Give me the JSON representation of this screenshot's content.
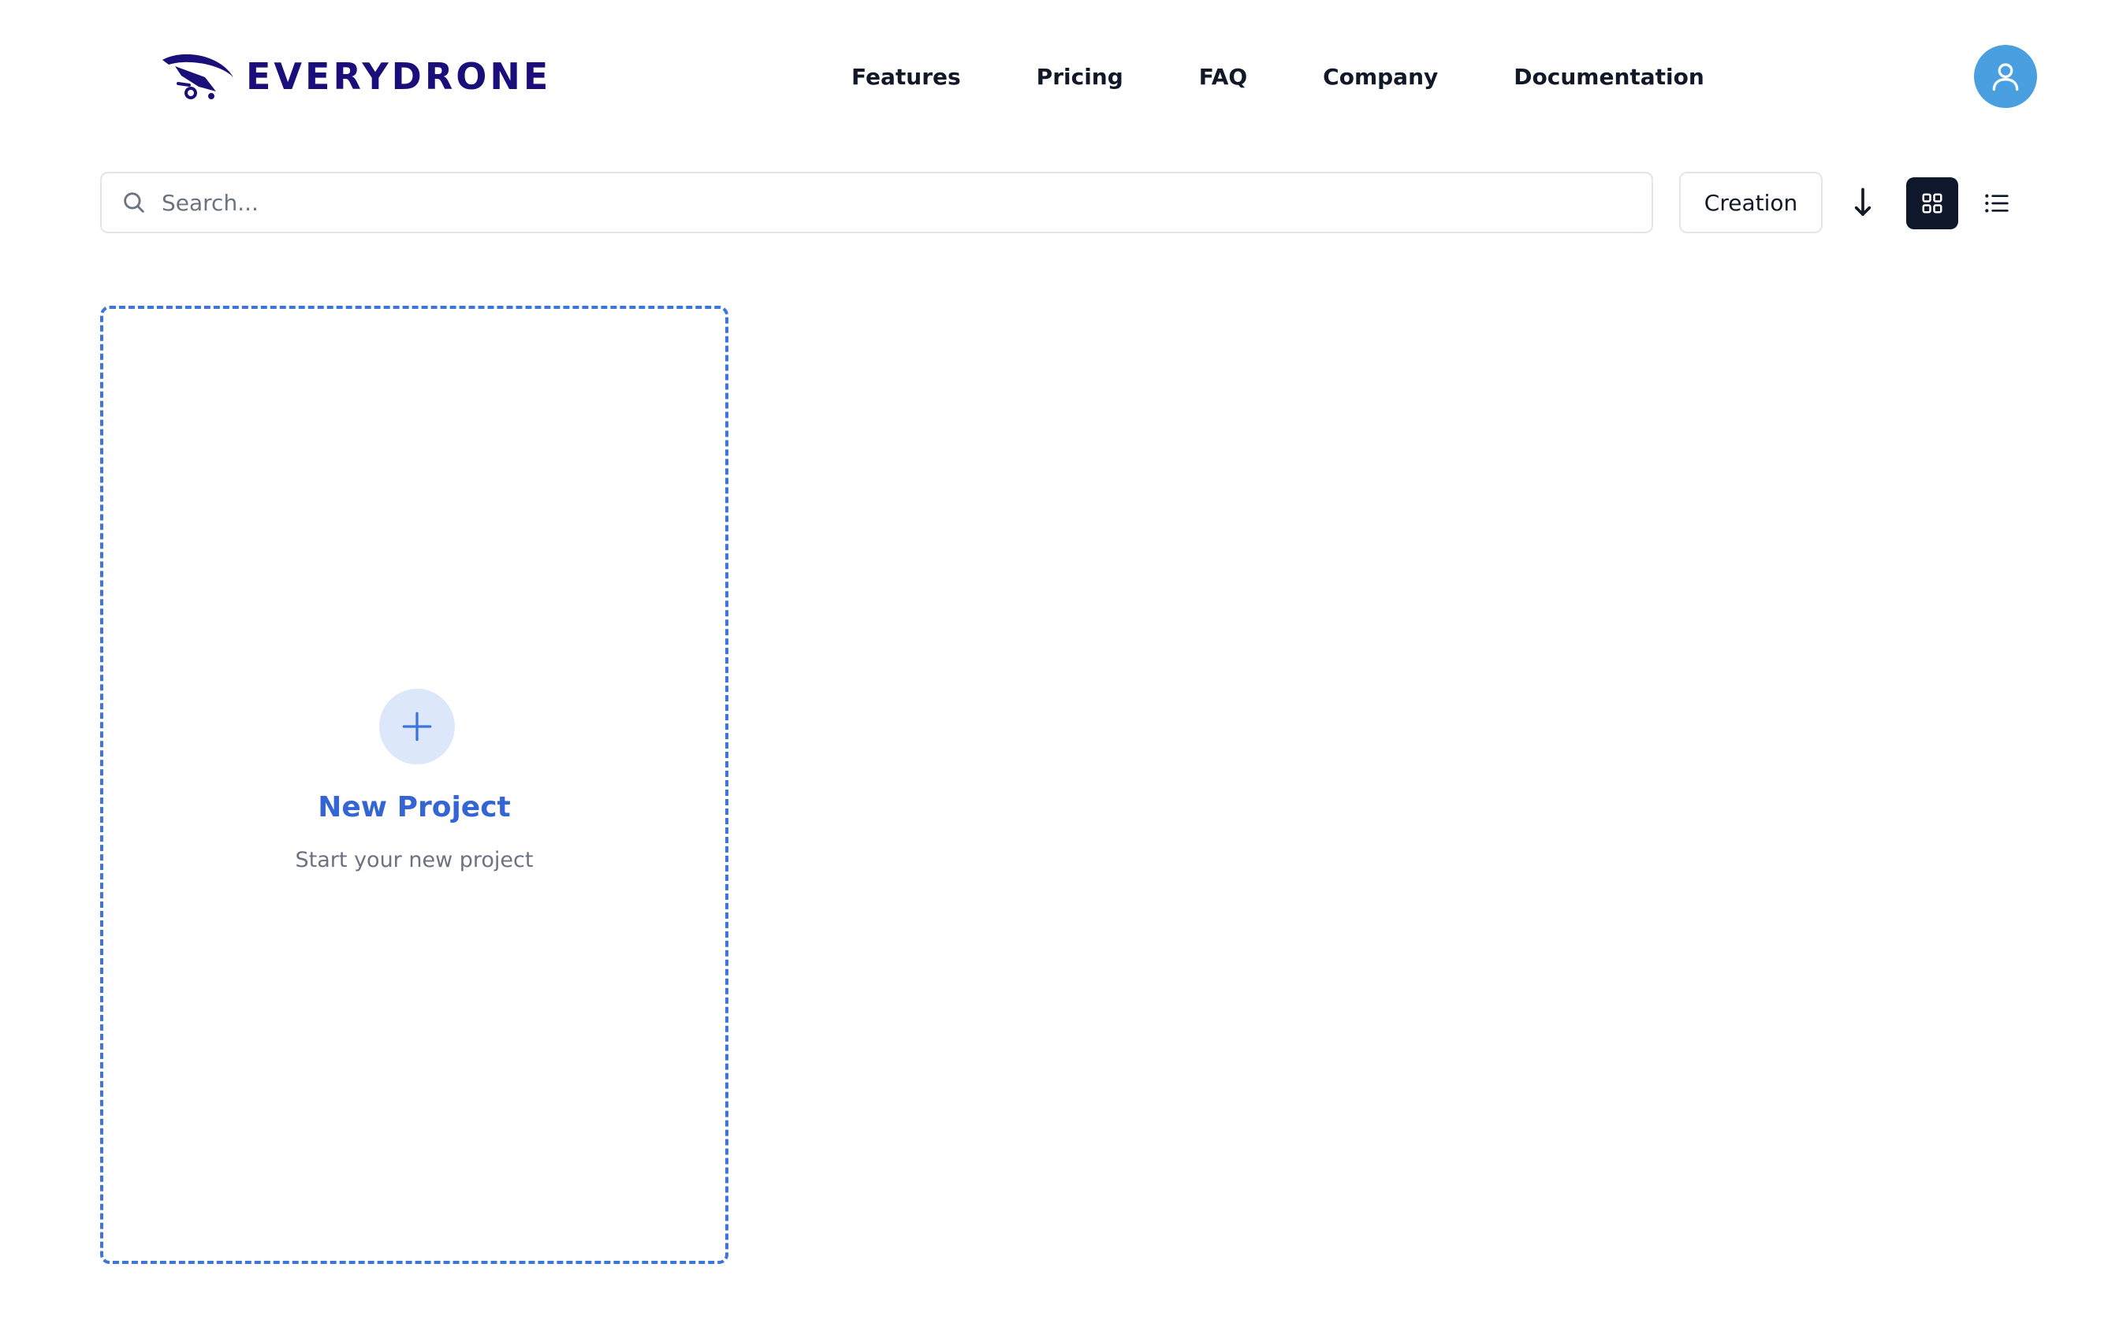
{
  "brand": {
    "name": "EVERYDRONE",
    "color": "#1a0f7a"
  },
  "nav": {
    "items": [
      {
        "label": "Features"
      },
      {
        "label": "Pricing"
      },
      {
        "label": "FAQ"
      },
      {
        "label": "Company"
      },
      {
        "label": "Documentation"
      }
    ]
  },
  "user": {
    "avatar_icon": "user-icon",
    "avatar_color": "#4a9fe0"
  },
  "toolbar": {
    "search_placeholder": "Search...",
    "search_value": "",
    "sort_field": "Creation",
    "sort_direction_icon": "arrow-down-icon",
    "view_mode": "grid",
    "grid_icon": "grid-icon",
    "list_icon": "list-icon"
  },
  "projects": {
    "new_card": {
      "title": "New Project",
      "subtitle": "Start your new project",
      "icon": "plus-icon",
      "accent": "#3c76dc"
    }
  }
}
